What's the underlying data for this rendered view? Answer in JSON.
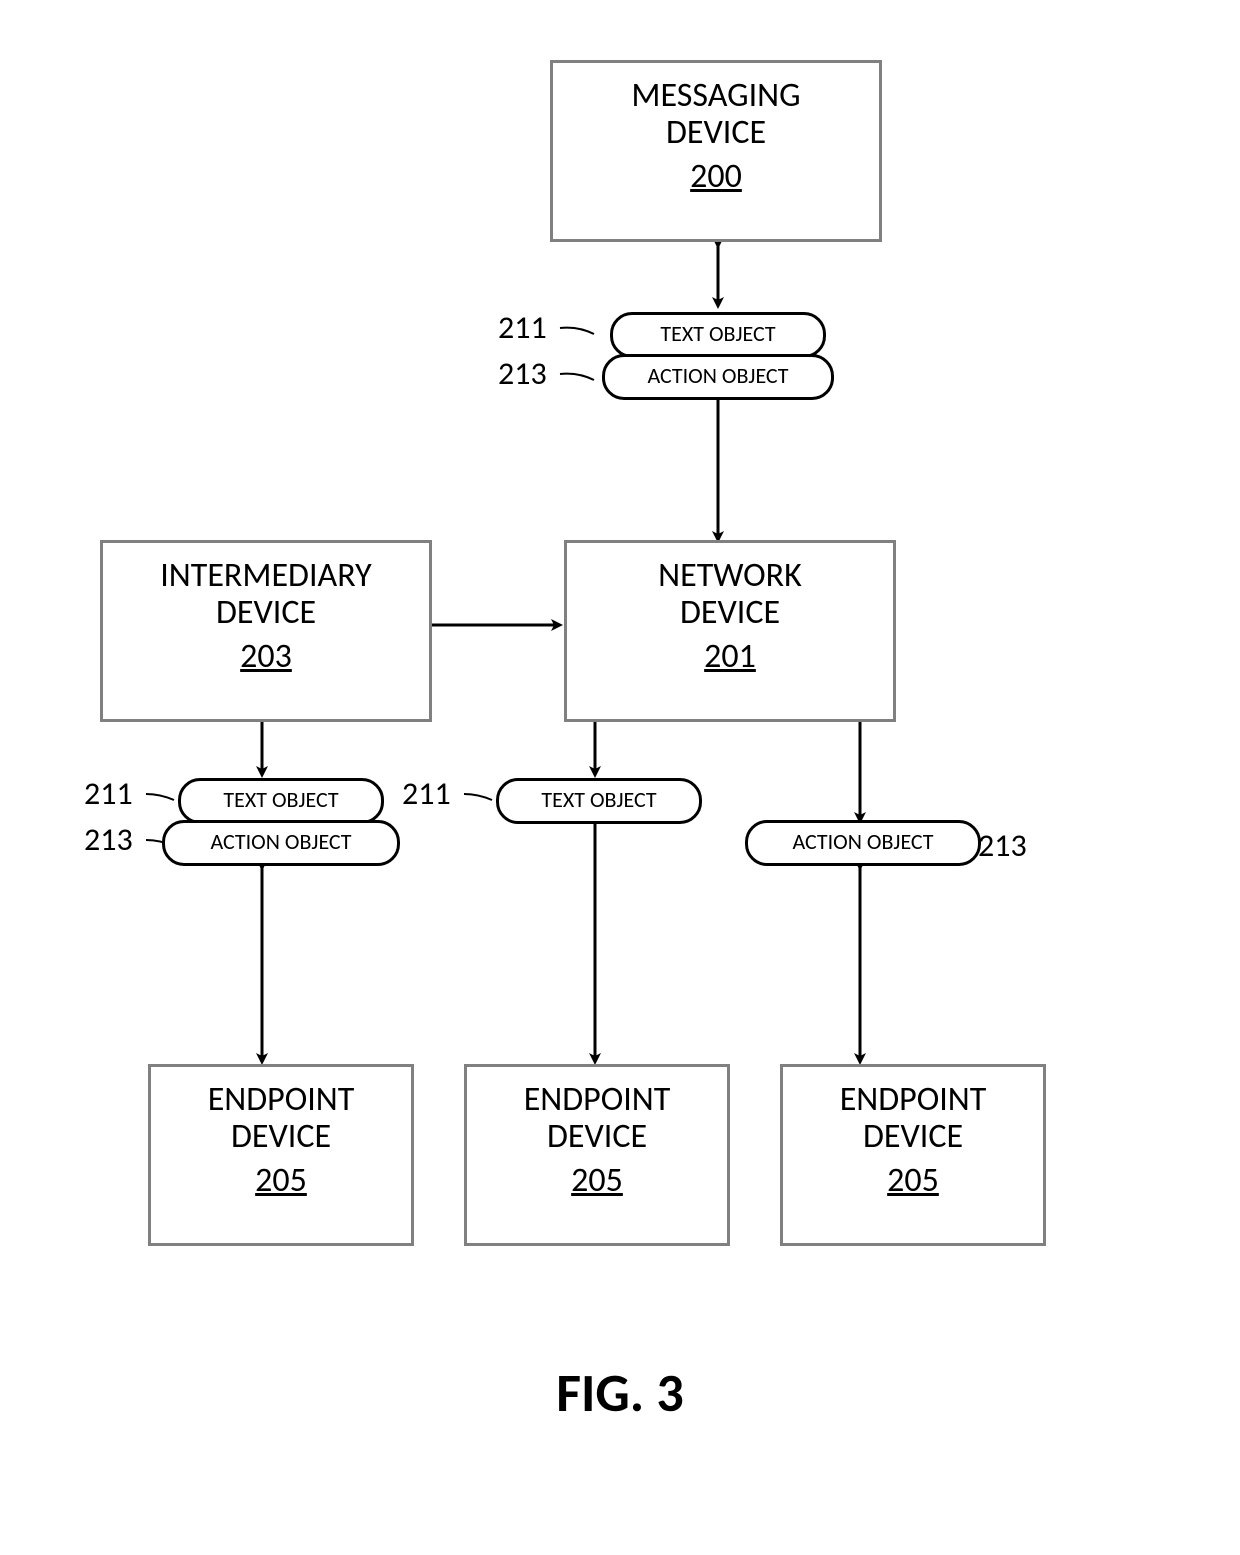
{
  "figure": "FIG. 3",
  "boxes": {
    "messaging": {
      "title": "MESSAGING DEVICE",
      "ref": "200"
    },
    "network": {
      "title": "NETWORK DEVICE",
      "ref": "201"
    },
    "intermediary": {
      "title": "INTERMEDIARY DEVICE",
      "ref": "203"
    },
    "endpoint": {
      "title": "ENDPOINT DEVICE",
      "ref": "205"
    }
  },
  "pills": {
    "text": "TEXT OBJECT",
    "action": "ACTION OBJECT"
  },
  "refs": {
    "text": "211",
    "action": "213"
  }
}
